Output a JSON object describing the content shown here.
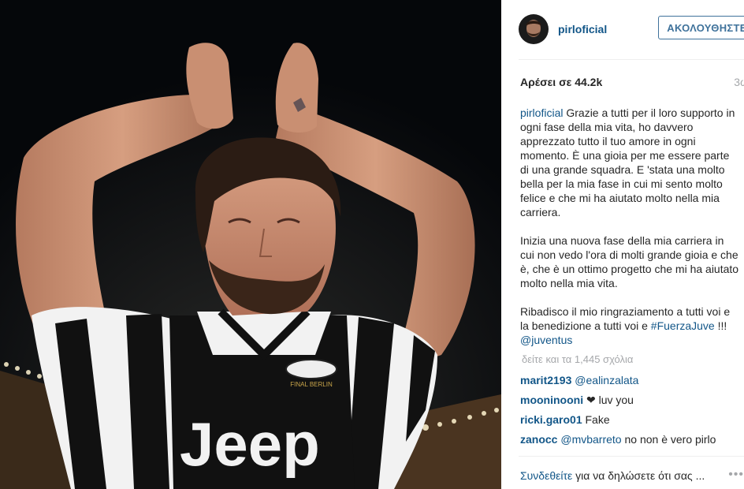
{
  "post": {
    "username": "pirloficial",
    "follow_label": "ΑΚΟΛΟΥΘΗΣΤΕ",
    "likes": "Αρέσει σε 44.2k",
    "time": "3ω",
    "caption_user": "pirloficial",
    "caption_p1": "Grazie a tutti per il loro supporto in ogni fase della mia vita, ho davvero apprezzato tutto il tuo amore in ogni momento. È una gioia per me essere parte di una grande squadra. E 'stata una molto bella per la mia fase in cui mi sento molto felice e che mi ha aiutato molto nella mia carriera.",
    "caption_p2": "Inizia una nuova fase della mia carriera in cui non vedo l'ora di molti grande gioia e che è, che è un ottimo progetto che mi ha aiutato molto nella mia vita.",
    "caption_p3_text": "Ribadisco il mio ringraziamento a tutti voi e la benedizione a tutti voi e",
    "hashtag": "#FuerzaJuve",
    "caption_p3_mid": "!!!",
    "mention": "@juventus",
    "view_comments": "δείτε και τα 1,445 σχόλια",
    "login_link": "Συνδεθείτε",
    "login_text": "για να δηλώσετε ότι σας ...",
    "more_dots": "•••"
  },
  "photo": {
    "jersey_text": "Jeep",
    "badge_text": "FINAL BERLIN"
  },
  "comments": [
    {
      "user": "marit2193",
      "mention": "@ealinzalata",
      "text": ""
    },
    {
      "user": "mooninooni",
      "mention": "",
      "text": "❤ luv you"
    },
    {
      "user": "ricki.garo01",
      "mention": "",
      "text": "Fake"
    },
    {
      "user": "zanocc",
      "mention": "@mvbarreto",
      "text": "no non è vero pirlo"
    }
  ],
  "colors": {
    "link": "#125688",
    "follow_border": "#3f729b",
    "muted": "#a5a7aa",
    "jersey_black": "#111111",
    "jersey_white": "#f2f2f2",
    "skin": "#c98f72"
  }
}
